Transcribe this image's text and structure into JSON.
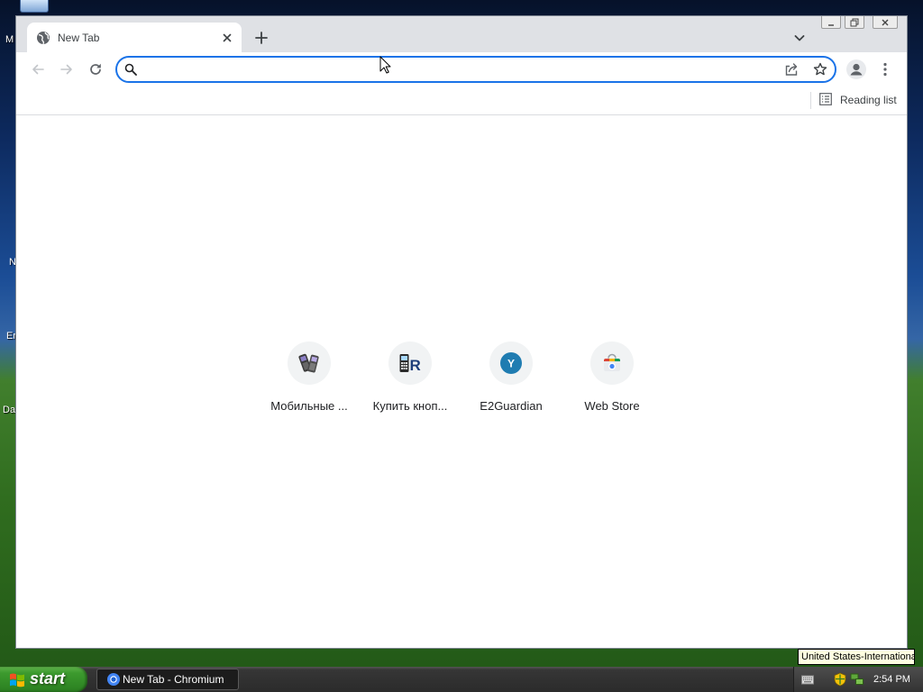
{
  "desktop": {
    "icon_labels": [
      "M",
      "N",
      "Er",
      "Da"
    ]
  },
  "browser": {
    "tabs": [
      {
        "title": "New Tab",
        "favicon": "globe-icon"
      }
    ],
    "toolbar": {
      "omnibox_value": "",
      "omnibox_placeholder": ""
    },
    "bookmarks_bar": {
      "reading_list_label": "Reading list"
    },
    "shortcuts": [
      {
        "title": "Мобильные ...",
        "icon": "mobile-phones-icon"
      },
      {
        "title": "Купить кноп...",
        "icon": "keypad-phone-logo-icon",
        "logo_letter": "R"
      },
      {
        "title": "E2Guardian",
        "icon": "letter-y-icon",
        "logo_letter": "Y"
      },
      {
        "title": "Web Store",
        "icon": "web-store-icon"
      }
    ]
  },
  "tooltip": {
    "text": "United States-International"
  },
  "taskbar": {
    "start_label": "start",
    "tasks": [
      {
        "title": "New Tab - Chromium",
        "icon": "chromium-icon"
      }
    ],
    "tray_icons": [
      "keyboard-icon",
      "security-shield-icon",
      "network-icon"
    ],
    "clock": "2:54 PM"
  },
  "colors": {
    "omnibox_focus_border": "#1a73e8",
    "tab_strip": "#dfe1e5",
    "start_button": "#3c9a2e",
    "taskbar": "#2b2b2b",
    "tooltip_background": "#ffffe1"
  }
}
